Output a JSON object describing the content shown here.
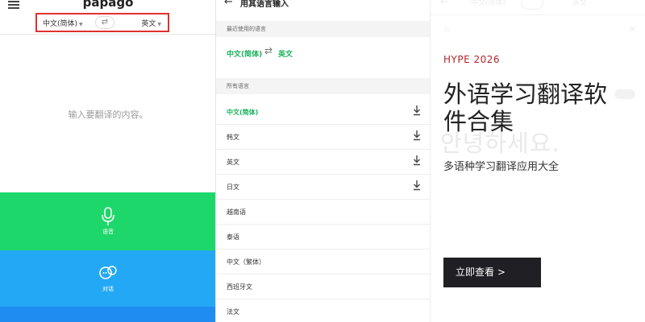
{
  "panel1": {
    "logo": "papago",
    "source_lang": "中文(简体)",
    "target_lang": "英文",
    "swap_glyph": "⇄",
    "input_placeholder": "输入要翻译的内容。",
    "voice_label": "语音",
    "conversation_label": "对话",
    "colors": {
      "voice": "#1ed76a",
      "conversation": "#23a8f5",
      "bottom": "#1e8cf0",
      "highlight_border": "#e03030"
    }
  },
  "panel2": {
    "title": "用其语言输入",
    "recent_section": "最近使用的语言",
    "recent_source": "中文(简体)",
    "recent_target": "英文",
    "all_section": "所有语言",
    "languages": [
      {
        "label": "中文(简体)",
        "downloadable": true,
        "selected": true
      },
      {
        "label": "韩文",
        "downloadable": true,
        "selected": false
      },
      {
        "label": "英文",
        "downloadable": true,
        "selected": false
      },
      {
        "label": "日文",
        "downloadable": true,
        "selected": false
      },
      {
        "label": "越南语",
        "downloadable": false,
        "selected": false
      },
      {
        "label": "泰语",
        "downloadable": false,
        "selected": false
      },
      {
        "label": "中文（繁体）",
        "downloadable": false,
        "selected": false
      },
      {
        "label": "西班牙文",
        "downloadable": false,
        "selected": false
      },
      {
        "label": "法文",
        "downloadable": false,
        "selected": false
      }
    ],
    "colors": {
      "accent": "#17b25a"
    }
  },
  "panel3": {
    "background": {
      "source_lang": "中文(简体)",
      "target_lang": "英文",
      "korean_text": "안녕하세요."
    },
    "hero": {
      "kicker": "HYPE 2026",
      "title": "外语学习翻译软件合集",
      "subtitle": "多语种学习翻译应用大全",
      "cta": "立即查看 >"
    },
    "colors": {
      "kicker": "#b3242b",
      "cta_bg": "#1f1f24"
    }
  }
}
